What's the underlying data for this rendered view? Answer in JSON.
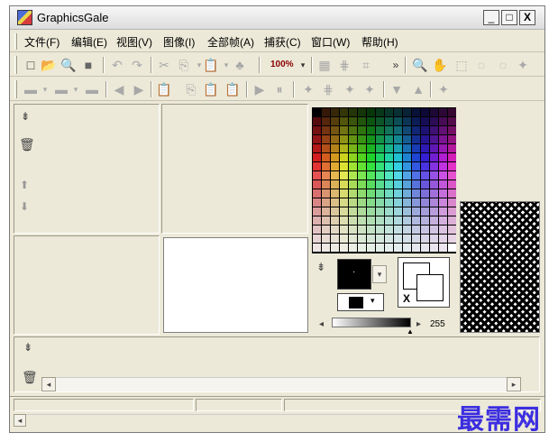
{
  "window": {
    "title": "GraphicsGale",
    "minimize": "_",
    "maximize": "□",
    "close": "X"
  },
  "menu": [
    {
      "label": "文件(F)"
    },
    {
      "label": "编辑(E)"
    },
    {
      "label": "视图(V)"
    },
    {
      "label": "图像(I)"
    },
    {
      "label": "全部帧(A)"
    },
    {
      "label": "捕获(C)"
    },
    {
      "label": "窗口(W)"
    },
    {
      "label": "帮助(H)"
    }
  ],
  "toolbar1": {
    "zoom_label": "100%",
    "more": "»"
  },
  "icons": {
    "new": "□",
    "open": "📂",
    "zoom": "🔍",
    "stop": "■",
    "undo": "↶",
    "redo": "↷",
    "cut": "✂",
    "copy": "⎘",
    "paste": "📋",
    "stamp": "♣",
    "grid": "▦",
    "grid2": "⋕",
    "crop": "⌗",
    "magnify": "🔍",
    "hand": "✋",
    "select": "⬚",
    "lasso": "◌",
    "wand": "✦",
    "frames": "▬",
    "prev": "◀",
    "next": "▶",
    "play": "▶",
    "pause": "⏸",
    "up": "▲",
    "down": "▼",
    "pin": "⇟",
    "trash": "🗑",
    "arrow_up": "⬆",
    "arrow_down": "⬇",
    "left": "◂",
    "right": "▸",
    "dropdown": "▾",
    "dot": "·"
  },
  "color_panel": {
    "alpha_value": "255",
    "swap_label": "X",
    "fg_color": "#000000",
    "bg_color": "#ffffff"
  },
  "watermark": "最需网"
}
